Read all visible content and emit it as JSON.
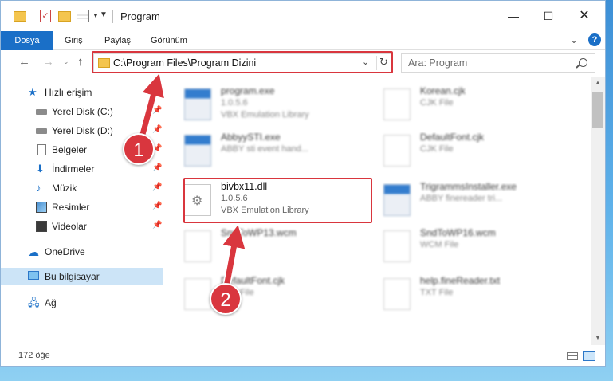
{
  "window": {
    "title": "Program",
    "min_glyph": "—",
    "max_glyph": "☐",
    "close_glyph": "✕"
  },
  "ribbon": {
    "tabs": [
      "Dosya",
      "Giriş",
      "Paylaş",
      "Görünüm"
    ],
    "file_tab_color": "#1a6fc7",
    "help_label": "?"
  },
  "nav": {
    "address": "C:\\Program Files\\Program Dizini",
    "search_placeholder": "Ara: Program"
  },
  "sidebar": {
    "items": [
      {
        "label": "Hızlı erişim",
        "icon": "star-icon"
      },
      {
        "label": "Yerel Disk (C:)",
        "icon": "disk-icon"
      },
      {
        "label": "Yerel Disk (D:)",
        "icon": "disk-icon"
      },
      {
        "label": "Belgeler",
        "icon": "documents-icon"
      },
      {
        "label": "İndirmeler",
        "icon": "download-icon"
      },
      {
        "label": "Müzik",
        "icon": "music-icon"
      },
      {
        "label": "Resimler",
        "icon": "pictures-icon"
      },
      {
        "label": "Videolar",
        "icon": "videos-icon"
      },
      {
        "label": "OneDrive",
        "icon": "cloud-icon"
      },
      {
        "label": "Bu bilgisayar",
        "icon": "computer-icon"
      },
      {
        "label": "Ağ",
        "icon": "network-icon"
      }
    ],
    "selected": "Bu bilgisayar"
  },
  "files": [
    {
      "name": "program.exe",
      "line1": "1.0.5.6",
      "line2": "VBX Emulation Library",
      "type": "exe"
    },
    {
      "name": "Korean.cjk",
      "line1": "CJK File",
      "line2": "",
      "type": "file"
    },
    {
      "name": "AbbyySTI.exe",
      "line1": "ABBY sti event hand...",
      "line2": "",
      "type": "exe"
    },
    {
      "name": "DefaultFont.cjk",
      "line1": "CJK File",
      "line2": "",
      "type": "file"
    },
    {
      "name": "bivbx11.dll",
      "line1": "1.0.5.6",
      "line2": "VBX Emulation Library",
      "type": "dll"
    },
    {
      "name": "TrigrammsInstaller.exe",
      "line1": "ABBY finereader tri...",
      "line2": "",
      "type": "exe"
    },
    {
      "name": "SndToWP13.wcm",
      "line1": "",
      "line2": "",
      "type": "file"
    },
    {
      "name": "SndToWP16.wcm",
      "line1": "WCM File",
      "line2": "",
      "type": "file"
    },
    {
      "name": "DefaultFont.cjk",
      "line1": "CJK File",
      "line2": "",
      "type": "file"
    },
    {
      "name": "help.fineReader.txt",
      "line1": "TXT File",
      "line2": "",
      "type": "file"
    }
  ],
  "status": {
    "item_count": "172 öğe"
  },
  "annotations": {
    "step1": "1",
    "step2": "2",
    "highlight_color": "#d9363e"
  }
}
